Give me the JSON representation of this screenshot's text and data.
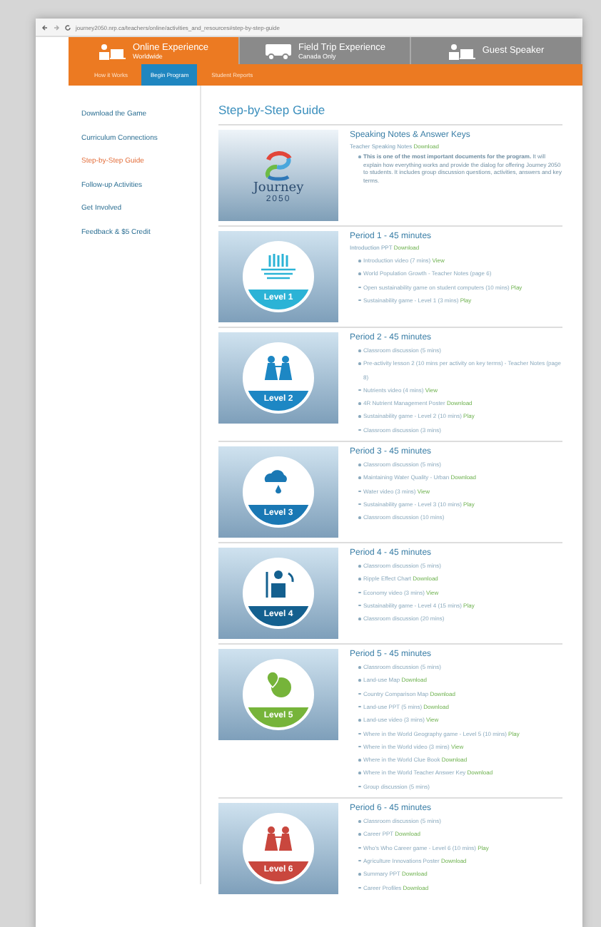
{
  "browser": {
    "address": "journey2050.nrp.ca/teachers/online/activities_and_resources#step-by-step-guide"
  },
  "header_tabs": [
    {
      "label": "Online Experience",
      "sub": "Worldwide",
      "selected": true
    },
    {
      "label": "Field Trip Experience",
      "sub": "Canada Only",
      "selected": false
    },
    {
      "label": "Guest Speaker",
      "selected": false
    }
  ],
  "nav": [
    {
      "label": "How it Works",
      "selected": false
    },
    {
      "label": "Begin Program",
      "selected": true
    },
    {
      "label": "Student Reports",
      "selected": false
    }
  ],
  "sidebar": {
    "items": [
      {
        "label": "Download the Game",
        "selected": false
      },
      {
        "label": "Curriculum Connections",
        "selected": false
      },
      {
        "label": "Step-by-Step Guide",
        "selected": true
      },
      {
        "label": "Follow-up Activities",
        "selected": false
      },
      {
        "label": "Get Involved",
        "selected": false
      },
      {
        "label": "Feedback & $5 Credit",
        "selected": false
      }
    ]
  },
  "guide": {
    "title": "Step-by-Step Guide",
    "intro": {
      "logo": [
        "Journey",
        "2050"
      ],
      "title": "Speaking Notes & Answer Keys",
      "subline": {
        "text": "Teacher Speaking Notes",
        "link": "Download"
      },
      "items": [
        {
          "text": "**This is one of the most important documents for the program.** It will explain how everything works and provide the dialog for offering Journey 2050 to students. It includes group discussion questions, activities, answers and key terms."
        }
      ]
    },
    "periods": [
      {
        "title": "Period 1 - 45 minutes",
        "level": "Level 1",
        "kind": "field",
        "color": "#2bb3d6",
        "subline": {
          "text": "Introduction PPT",
          "link": "Download"
        },
        "items": [
          {
            "text": "Introduction video (7 mins)",
            "link": "View"
          },
          {
            "text": "World Population Growth - Teacher Notes (page 6)"
          },
          {
            "text": "Open sustainability game on student computers (10 mins)",
            "link": "Play"
          },
          {
            "text": "Sustainability game - Level 1 (3 mins)",
            "link": "Play"
          }
        ]
      },
      {
        "title": "Period 2 - 45 minutes",
        "level": "Level 2",
        "kind": "people",
        "color": "#1d87c4",
        "items": [
          {
            "text": "Classroom discussion (5 mins)"
          },
          {
            "text": "Pre-activity lesson 2 (10 mins per activity on key terms) - Teacher Notes (page 8)"
          },
          {
            "text": "Nutrients video (4 mins)",
            "link": "View"
          },
          {
            "text": "4R Nutrient Management Poster",
            "link": "Download"
          },
          {
            "text": "Sustainability game - Level 2 (10 mins)",
            "link": "Play"
          },
          {
            "text": "Classroom discussion (3 mins)"
          }
        ]
      },
      {
        "title": "Period 3 - 45 minutes",
        "level": "Level 3",
        "kind": "rain",
        "color": "#1a78b4",
        "items": [
          {
            "text": "Classroom discussion (5 mins)"
          },
          {
            "text": "Maintaining Water Quality - Urban",
            "link": "Download"
          },
          {
            "text": "Water video (3 mins)",
            "link": "View"
          },
          {
            "text": "Sustainability game - Level 3 (10 mins)",
            "link": "Play"
          },
          {
            "text": "Classroom discussion (10 mins)"
          }
        ]
      },
      {
        "title": "Period 4 - 45 minutes",
        "level": "Level 4",
        "kind": "farmer",
        "color": "#14608f",
        "items": [
          {
            "text": "Classroom discussion (5 mins)"
          },
          {
            "text": "Ripple Effect Chart",
            "link": "Download"
          },
          {
            "text": "Economy video (3 mins)",
            "link": "View"
          },
          {
            "text": "Sustainability game - Level 4 (15 mins)",
            "link": "Play"
          },
          {
            "text": "Classroom discussion (20 mins)"
          }
        ]
      },
      {
        "title": "Period 5 - 45 minutes",
        "level": "Level 5",
        "kind": "globe",
        "color": "#76b43a",
        "items": [
          {
            "text": "Classroom discussion (5 mins)"
          },
          {
            "text": "Land-use Map",
            "link": "Download"
          },
          {
            "text": "Country Comparison Map",
            "link": "Download"
          },
          {
            "text": "Land-use PPT (5 mins)",
            "link": "Download"
          },
          {
            "text": "Land-use video (3 mins)",
            "link": "View"
          },
          {
            "text": "Where in the World Geography game - Level 5 (10 mins)",
            "link": "Play"
          },
          {
            "text": "Where in the World video (3 mins)",
            "link": "View"
          },
          {
            "text": "Where in the World Clue Book",
            "link": "Download"
          },
          {
            "text": "Where in the World Teacher Answer Key",
            "link": "Download"
          },
          {
            "text": "Group discussion (5 mins)"
          }
        ]
      },
      {
        "title": "Period 6 - 45 minutes",
        "level": "Level 6",
        "kind": "people",
        "color": "#c9473e",
        "items": [
          {
            "text": "Classroom discussion (5 mins)"
          },
          {
            "text": "Career PPT",
            "link": "Download"
          },
          {
            "text": "Who's Who Career game - Level 6 (10 mins)",
            "link": "Play"
          },
          {
            "text": "Agriculture Innovations Poster",
            "link": "Download"
          },
          {
            "text": "Summary PPT",
            "link": "Download"
          },
          {
            "text": "Career Profiles",
            "link": "Download"
          }
        ]
      }
    ]
  }
}
